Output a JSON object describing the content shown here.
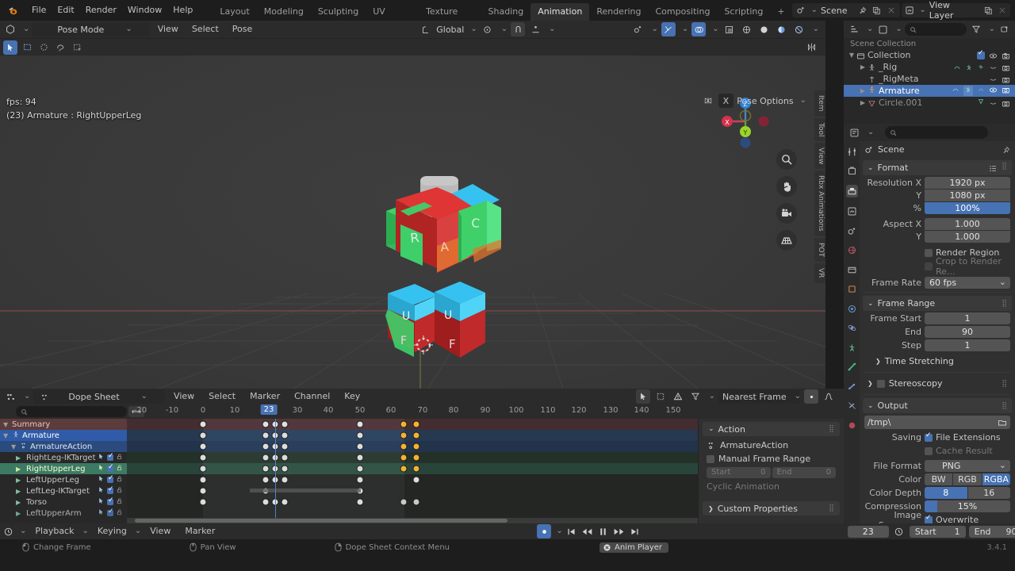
{
  "app": {
    "version": "3.4.1",
    "accent_blue": "#4772b3",
    "bg_dark": "#1d1d1d",
    "bg_panel": "#303030"
  },
  "topbar": {
    "logo_icon": "blender-logo-icon",
    "menus": [
      "File",
      "Edit",
      "Render",
      "Window",
      "Help"
    ],
    "workspaces": [
      {
        "label": "Layout",
        "active": false
      },
      {
        "label": "Modeling",
        "active": false
      },
      {
        "label": "Sculpting",
        "active": false
      },
      {
        "label": "UV Editing",
        "active": false
      },
      {
        "label": "Texture Paint",
        "active": false
      },
      {
        "label": "Shading",
        "active": false
      },
      {
        "label": "Animation",
        "active": true
      },
      {
        "label": "Rendering",
        "active": false
      },
      {
        "label": "Compositing",
        "active": false
      },
      {
        "label": "Scripting",
        "active": false
      },
      {
        "label": "+",
        "active": false
      }
    ],
    "scene": {
      "icon": "scene-icon",
      "name": "Scene",
      "pin_icon": "pin-icon",
      "copy_icon": "duplicate-icon",
      "close_icon": "close-icon"
    },
    "viewlayer": {
      "icon": "viewlayer-icon",
      "name": "View Layer",
      "copy_icon": "duplicate-icon",
      "close_icon": "close-icon"
    }
  },
  "viewport": {
    "header": {
      "editor_icon": "editor-type-3dview-icon",
      "mode": "Pose Mode",
      "menus": [
        "View",
        "Select",
        "Pose"
      ],
      "transform_orientation": "Global",
      "pivot_icon": "pivot-point-icon",
      "snap_icon": "snap-magnet-icon",
      "proportional_icon": "proportional-edit-icon",
      "visibility_icon": "object-visibility-icon",
      "gizmo_icon": "gizmo-icon",
      "overlays_icon": "overlays-icon",
      "xray_icon": "xray-icon",
      "shading_wireframe_icon": "shading-wireframe-icon",
      "shading_solid_icon": "shading-solid-icon",
      "shading_material_icon": "shading-material-icon",
      "shading_rendered_icon": "shading-rendered-icon"
    },
    "pose_options": {
      "label": "Pose Options",
      "xmirror_icon": "butterfly-mirror-icon",
      "x_label": "X"
    },
    "overlay": {
      "fps": "fps: 94",
      "info": "(23) Armature : RightUpperLeg"
    },
    "gizmo": {
      "x": "X",
      "y": "Y",
      "z": "Z"
    },
    "tools": [
      "zoom-icon",
      "hand-pan-icon",
      "camera-view-icon",
      "orthographic-toggle-icon"
    ],
    "side_tabs": [
      "Item",
      "Tool",
      "View",
      "Rbx Animations",
      "POT",
      "VR"
    ]
  },
  "outliner": {
    "header": {
      "display_mode_icon": "outliner-icon",
      "filter_icon": "filter-funnel-icon",
      "search_placeholder": "",
      "search_icon": "search-icon",
      "new_collection_icon": "new-collection-icon"
    },
    "scene_collection": "Scene Collection",
    "rows": [
      {
        "label": "Collection",
        "indent": 0,
        "icon": "collection-icon",
        "disclosure": "open",
        "selected": false,
        "checkbox": true,
        "eye": true,
        "camera": true
      },
      {
        "label": "_Rig",
        "indent": 1,
        "icon": "armature-icon",
        "disclosure": "closed",
        "selected": false,
        "eye": false,
        "camera": true
      },
      {
        "label": "_RigMeta",
        "indent": 1,
        "icon": "empty-icon",
        "disclosure": "none",
        "selected": false,
        "eye": false,
        "camera": true
      },
      {
        "label": "Armature",
        "indent": 1,
        "icon": "armature-icon",
        "disclosure": "closed",
        "selected": true,
        "eye": true,
        "camera": true
      },
      {
        "label": "Circle.001",
        "indent": 1,
        "icon": "curve-icon",
        "disclosure": "closed",
        "selected": false,
        "eye": false,
        "camera": true
      }
    ]
  },
  "properties": {
    "header": {
      "editor_icon": "properties-editor-icon",
      "search_placeholder": "",
      "search_icon": "search-icon"
    },
    "nav_tabs": [
      "tool-icon",
      "render-icon",
      "output-icon",
      "viewlayer-icon",
      "scene-icon",
      "world-icon",
      "collection-props-icon",
      "object-icon",
      "modifiers-icon",
      "physics-icon",
      "constraints-icon",
      "armature-data-icon",
      "bone-icon",
      "bone-constraint-icon",
      "material-icon"
    ],
    "breadcrumb": {
      "icon": "scene-icon",
      "label": "Scene"
    },
    "format": {
      "title": "Format",
      "presets_icon": "presets-icon",
      "rows": [
        {
          "label": "Resolution X",
          "value": "1920 px",
          "style": "top"
        },
        {
          "label": "Y",
          "value": "1080 px",
          "style": "mid"
        },
        {
          "label": "%",
          "value": "100%",
          "style": "bot",
          "highlight": true
        },
        {
          "label": "Aspect X",
          "value": "1.000",
          "style": "top"
        },
        {
          "label": "Y",
          "value": "1.000",
          "style": "bot"
        }
      ],
      "render_region": {
        "label": "Render Region",
        "checked": false
      },
      "crop_render_region": {
        "label": "Crop to Render Re...",
        "checked": false,
        "disabled": true
      },
      "frame_rate": {
        "label": "Frame Rate",
        "value": "60 fps"
      }
    },
    "frame_range": {
      "title": "Frame Range",
      "rows": [
        {
          "label": "Frame Start",
          "value": "1"
        },
        {
          "label": "End",
          "value": "90"
        },
        {
          "label": "Step",
          "value": "1"
        }
      ]
    },
    "time_stretching": {
      "title": "Time Stretching"
    },
    "stereoscopy": {
      "title": "Stereoscopy",
      "checked": false
    },
    "output": {
      "title": "Output",
      "path": "/tmp\\",
      "folder_icon": "folder-icon",
      "saving_label": "Saving",
      "file_extensions": {
        "label": "File Extensions",
        "checked": true
      },
      "cache_result": {
        "label": "Cache Result",
        "checked": false
      },
      "file_format": {
        "label": "File Format",
        "value": "PNG",
        "icon": "image-file-icon"
      },
      "color": {
        "label": "Color",
        "options": [
          "BW",
          "RGB",
          "RGBA"
        ],
        "selected": "RGBA"
      },
      "color_depth": {
        "label": "Color Depth",
        "options": [
          "8",
          "16"
        ],
        "selected": "8"
      },
      "compression": {
        "label": "Compression",
        "value": "15%",
        "percent": 15
      },
      "image_sequence": {
        "label": "Image Sequence",
        "overwrite_label": "Overwrite",
        "checked": true
      }
    }
  },
  "dopesheet": {
    "header": {
      "editor_icon": "editor-type-dopesheet-icon",
      "mode_icon": "dopesheet-mode-icon",
      "mode": "Dope Sheet",
      "menus": [
        "View",
        "Select",
        "Marker",
        "Channel",
        "Key"
      ],
      "only_show_selected_icon": "arrow-cursor-icon",
      "show_hidden_icon": "show-hidden-icon",
      "only_errors_icon": "warning-triangle-icon",
      "filter_icon": "filter-funnel-icon",
      "snapping": "Nearest Frame",
      "proportional_icon": "proportional-edit-icon",
      "falloff_icon": "falloff-curve-icon"
    },
    "search_placeholder": "",
    "search_icon": "search-icon",
    "resize_icon": "horizontal-resize-icon",
    "ruler_ticks": [
      "-20",
      "-10",
      "0",
      "10",
      "20",
      "30",
      "40",
      "50",
      "60",
      "70",
      "80",
      "90",
      "100",
      "110",
      "120",
      "130",
      "140",
      "150"
    ],
    "current_frame": "23",
    "channels": [
      {
        "label": "Summary",
        "kind": "summary",
        "indent": 0,
        "disclosure": "open"
      },
      {
        "label": "Armature",
        "kind": "armature",
        "indent": 0,
        "disclosure": "open",
        "icon": "armature-icon"
      },
      {
        "label": "ArmatureAction",
        "kind": "action",
        "indent": 1,
        "disclosure": "open",
        "icon": "action-icon"
      },
      {
        "label": "RightLeg-IKTarget",
        "kind": "bone",
        "indent": 2,
        "disclosure": "closed"
      },
      {
        "label": "RightUpperLeg",
        "kind": "bone",
        "indent": 2,
        "disclosure": "closed",
        "selected": true
      },
      {
        "label": "LeftUpperLeg",
        "kind": "bone",
        "indent": 2,
        "disclosure": "closed"
      },
      {
        "label": "LeftLeg-IKTarget",
        "kind": "bone",
        "indent": 2,
        "disclosure": "closed"
      },
      {
        "label": "Torso",
        "kind": "bone",
        "indent": 2,
        "disclosure": "closed"
      },
      {
        "label": "LeftUpperArm",
        "kind": "bone",
        "indent": 2,
        "disclosure": "closed"
      }
    ],
    "keyframes": [
      {
        "row": 0,
        "frames": [
          0,
          20,
          23,
          26,
          50,
          64,
          68
        ],
        "selected": [
          64,
          68
        ]
      },
      {
        "row": 1,
        "frames": [
          0,
          20,
          23,
          26,
          50,
          64,
          68
        ],
        "selected": [
          64,
          68
        ]
      },
      {
        "row": 2,
        "frames": [
          0,
          20,
          23,
          26,
          50,
          64,
          68
        ],
        "selected": [
          64,
          68
        ]
      },
      {
        "row": 3,
        "frames": [
          0,
          20,
          23,
          26,
          50,
          64,
          68
        ],
        "selected": [
          64,
          68
        ]
      },
      {
        "row": 4,
        "frames": [
          0,
          20,
          23,
          26,
          50,
          64,
          68
        ],
        "selected": [
          64,
          68
        ]
      },
      {
        "row": 5,
        "frames": [
          0,
          20,
          23,
          26,
          50,
          68
        ],
        "selected": []
      },
      {
        "row": 6,
        "frames": [
          0,
          20,
          50
        ],
        "selected": []
      },
      {
        "row": 7,
        "frames": [
          0,
          20,
          23,
          26,
          50,
          64,
          68
        ],
        "selected": []
      }
    ],
    "action_panel": {
      "title": "Action",
      "action_name": "ArmatureAction",
      "action_icon": "action-icon",
      "manual_frame_range": {
        "label": "Manual Frame Range",
        "checked": false
      },
      "start": {
        "label": "Start",
        "value": "0"
      },
      "end": {
        "label": "End",
        "value": "0"
      },
      "cyclic_animation": {
        "label": "Cyclic Animation",
        "checked": false
      },
      "custom_properties": "Custom Properties"
    }
  },
  "timeline": {
    "editor_icon": "editor-type-timeline-icon",
    "menus": [
      {
        "label": "Playback",
        "dropdown": true
      },
      {
        "label": "Keying",
        "dropdown": true
      },
      {
        "label": "View",
        "dropdown": false
      },
      {
        "label": "Marker",
        "dropdown": false
      }
    ],
    "keyframe_type_icon": "keyframe-type-icon",
    "transport": [
      "jump-to-start-icon",
      "prev-keyframe-icon",
      "pause-icon",
      "next-keyframe-icon",
      "jump-to-end-icon"
    ],
    "current_frame": "23",
    "auto_key_icon": "auto-keying-icon",
    "start_label": "Start",
    "start_value": "1",
    "end_label": "End",
    "end_value": "90"
  },
  "status_bar": {
    "hints": [
      {
        "mouse": "left-mouse-icon",
        "label": "Change Frame"
      },
      {
        "mouse": "middle-mouse-icon",
        "label": "Pan View"
      },
      {
        "mouse": "right-mouse-icon",
        "label": "Dope Sheet Context Menu"
      }
    ],
    "anim_player": {
      "icon": "close-circle-icon",
      "label": "Anim Player"
    },
    "version": "3.4.1"
  }
}
